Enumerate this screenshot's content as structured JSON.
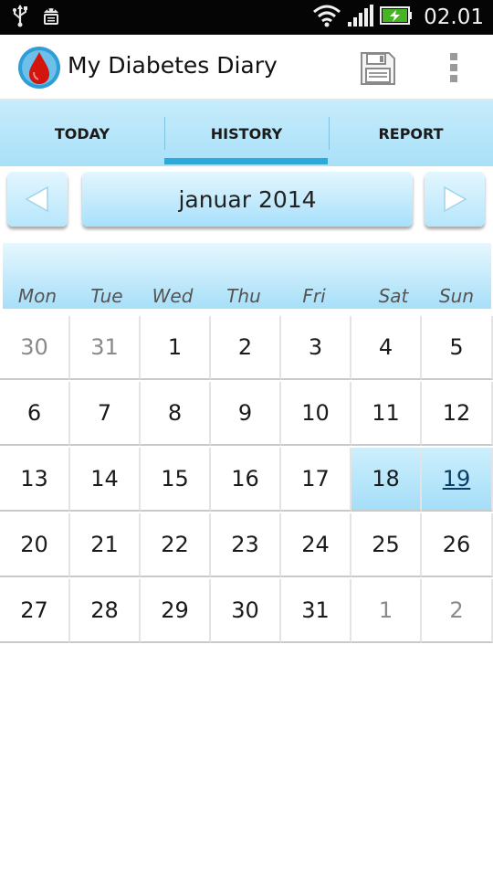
{
  "status_bar": {
    "time": "02.01",
    "icons": [
      "usb-icon",
      "android-debug-icon",
      "wifi-icon",
      "signal-icon",
      "battery-charging-icon"
    ]
  },
  "app": {
    "title": "My Diabetes Diary",
    "icons": [
      "blood-drop-logo-icon",
      "save-icon",
      "overflow-menu-icon"
    ]
  },
  "tabs": [
    {
      "label": "TODAY",
      "active": false
    },
    {
      "label": "HISTORY",
      "active": true
    },
    {
      "label": "REPORT",
      "active": false
    }
  ],
  "month_nav": {
    "month_label": "januar 2014",
    "prev_icon": "arrow-left-icon",
    "next_icon": "arrow-right-icon"
  },
  "weekdays": [
    "Mon",
    "Tue",
    "Wed",
    "Thu",
    "Fri",
    "Sat",
    "Sun"
  ],
  "weeks": [
    [
      {
        "d": "30",
        "other": true
      },
      {
        "d": "31",
        "other": true
      },
      {
        "d": "1"
      },
      {
        "d": "2"
      },
      {
        "d": "3"
      },
      {
        "d": "4"
      },
      {
        "d": "5"
      }
    ],
    [
      {
        "d": "6"
      },
      {
        "d": "7"
      },
      {
        "d": "8"
      },
      {
        "d": "9"
      },
      {
        "d": "10"
      },
      {
        "d": "11"
      },
      {
        "d": "12"
      }
    ],
    [
      {
        "d": "13"
      },
      {
        "d": "14"
      },
      {
        "d": "15"
      },
      {
        "d": "16"
      },
      {
        "d": "17"
      },
      {
        "d": "18",
        "highlight": true
      },
      {
        "d": "19",
        "highlight": true,
        "today": true
      }
    ],
    [
      {
        "d": "20"
      },
      {
        "d": "21"
      },
      {
        "d": "22"
      },
      {
        "d": "23"
      },
      {
        "d": "24"
      },
      {
        "d": "25"
      },
      {
        "d": "26"
      }
    ],
    [
      {
        "d": "27"
      },
      {
        "d": "28"
      },
      {
        "d": "29"
      },
      {
        "d": "30"
      },
      {
        "d": "31"
      },
      {
        "d": "1",
        "other": true
      },
      {
        "d": "2",
        "other": true
      }
    ]
  ],
  "colors": {
    "accent": "#2aa9dd",
    "tab_bg": "#b5e5f9",
    "highlight": "#b8e6fa",
    "today_text": "#0a3d66"
  }
}
